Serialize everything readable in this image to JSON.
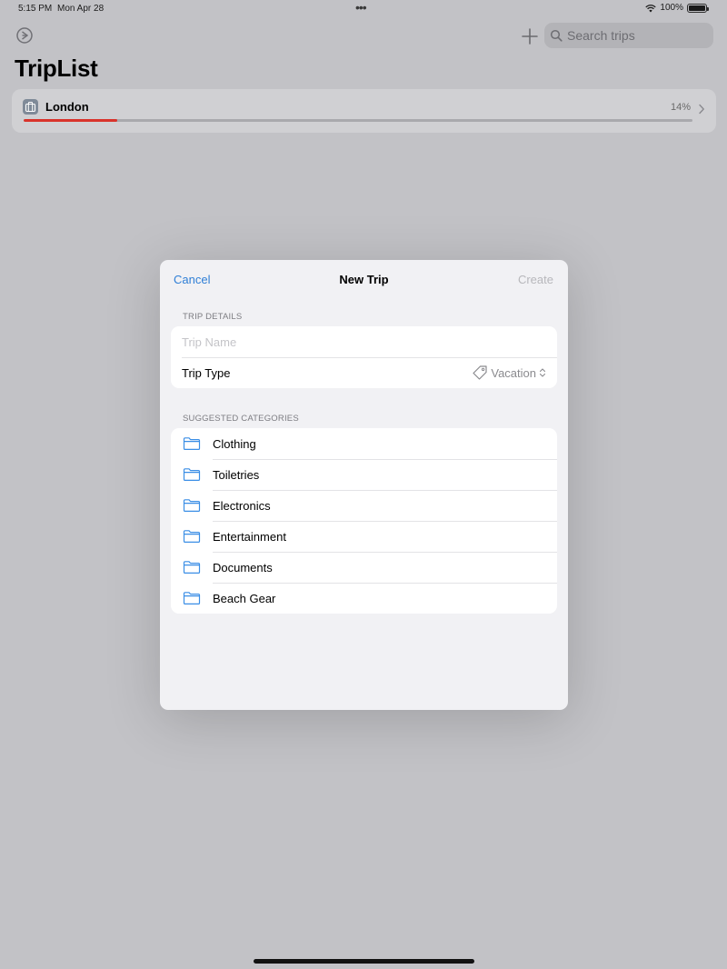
{
  "status_bar": {
    "time": "5:15 PM",
    "date": "Mon Apr 28",
    "dots": "•••",
    "battery": "100%"
  },
  "nav": {
    "search_placeholder": "Search trips"
  },
  "app": {
    "title": "TripList"
  },
  "trips": [
    {
      "name": "London",
      "percent_label": "14%",
      "progress": 0.14,
      "progress_color": "#d9332b"
    }
  ],
  "modal": {
    "cancel_label": "Cancel",
    "title": "New Trip",
    "create_label": "Create",
    "details_header": "TRIP DETAILS",
    "trip_name_placeholder": "Trip Name",
    "trip_type_label": "Trip Type",
    "trip_type_value": "Vacation",
    "categories_header": "SUGGESTED CATEGORIES",
    "categories": [
      {
        "label": "Clothing"
      },
      {
        "label": "Toiletries"
      },
      {
        "label": "Electronics"
      },
      {
        "label": "Entertainment"
      },
      {
        "label": "Documents"
      },
      {
        "label": "Beach Gear"
      }
    ]
  },
  "colors": {
    "accent": "#2f7fd6",
    "disabled": "#b7b7bb",
    "backdrop": "#c2c2c6"
  }
}
